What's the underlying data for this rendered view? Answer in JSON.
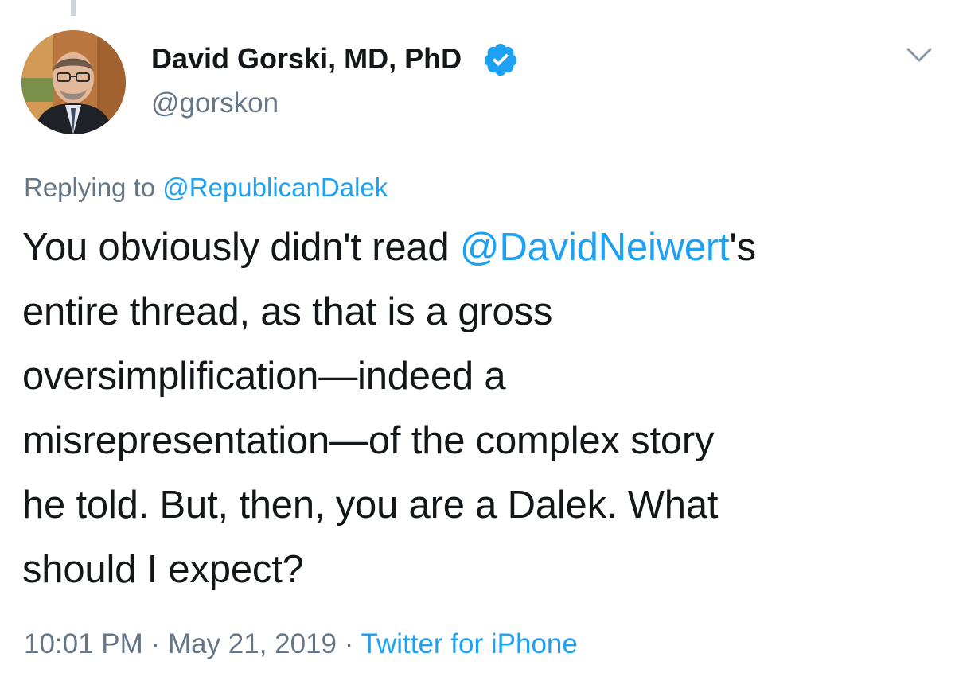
{
  "tweet": {
    "author": {
      "display_name": "David Gorski, MD, PhD",
      "handle": "@gorskon",
      "verified": true,
      "avatar": "author-portrait"
    },
    "reply_prefix": "Replying to ",
    "reply_to": "@RepublicanDalek",
    "text_lines": {
      "line1_before": "You obviously didn't read ",
      "line1_mention": "@DavidNeiwert",
      "line1_after": "'s",
      "line2": "entire thread, as that is a gross",
      "line3": "oversimplification—indeed a",
      "line4": "misrepresentation—of the complex story",
      "line5": "he told. But, then, you are a Dalek. What",
      "line6": "should I expect?"
    },
    "time": "10:01 PM",
    "separator": "·",
    "date": "May 21, 2019",
    "source": "Twitter for iPhone"
  },
  "colors": {
    "text": "#14171a",
    "secondary": "#657786",
    "link": "#1da1f2",
    "thread_line": "#cdd6dd"
  },
  "icons": {
    "verified": "verified-badge-icon",
    "menu": "chevron-down-icon"
  }
}
